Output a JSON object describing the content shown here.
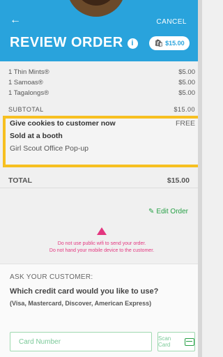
{
  "header": {
    "back_glyph": "←",
    "cancel_label": "CANCEL",
    "title": "REVIEW ORDER",
    "info_glyph": "i",
    "cart_total": "$15.00",
    "accent_color": "#29a3dc"
  },
  "order": {
    "items": [
      {
        "name": "1 Thin Mints®",
        "price": "$5.00"
      },
      {
        "name": "1 Samoas®",
        "price": "$5.00"
      },
      {
        "name": "1 Tagalongs®",
        "price": "$5.00"
      }
    ],
    "subtotal_label": "SUBTOTAL",
    "subtotal_value": "$15.00"
  },
  "delivery": {
    "method": "Give cookies to customer now",
    "method_price": "FREE",
    "sale_type": "Sold at a booth",
    "location": "Girl Scout Office Pop-up",
    "highlight_color": "#f7c021"
  },
  "total": {
    "label": "TOTAL",
    "value": "$15.00"
  },
  "edit_order_label": "Edit Order",
  "warning": {
    "line1": "Do not use public wifi to send your order.",
    "line2": "Do not hand your mobile device to the customer.",
    "color": "#e3367f"
  },
  "ask": {
    "label": "ASK YOUR CUSTOMER:",
    "question": "Which credit card would you like to use?",
    "cards": "(Visa, Mastercard, Discover, American Express)"
  },
  "card_input": {
    "placeholder": "Card Number",
    "value": ""
  },
  "scan_label": "Scan Card"
}
